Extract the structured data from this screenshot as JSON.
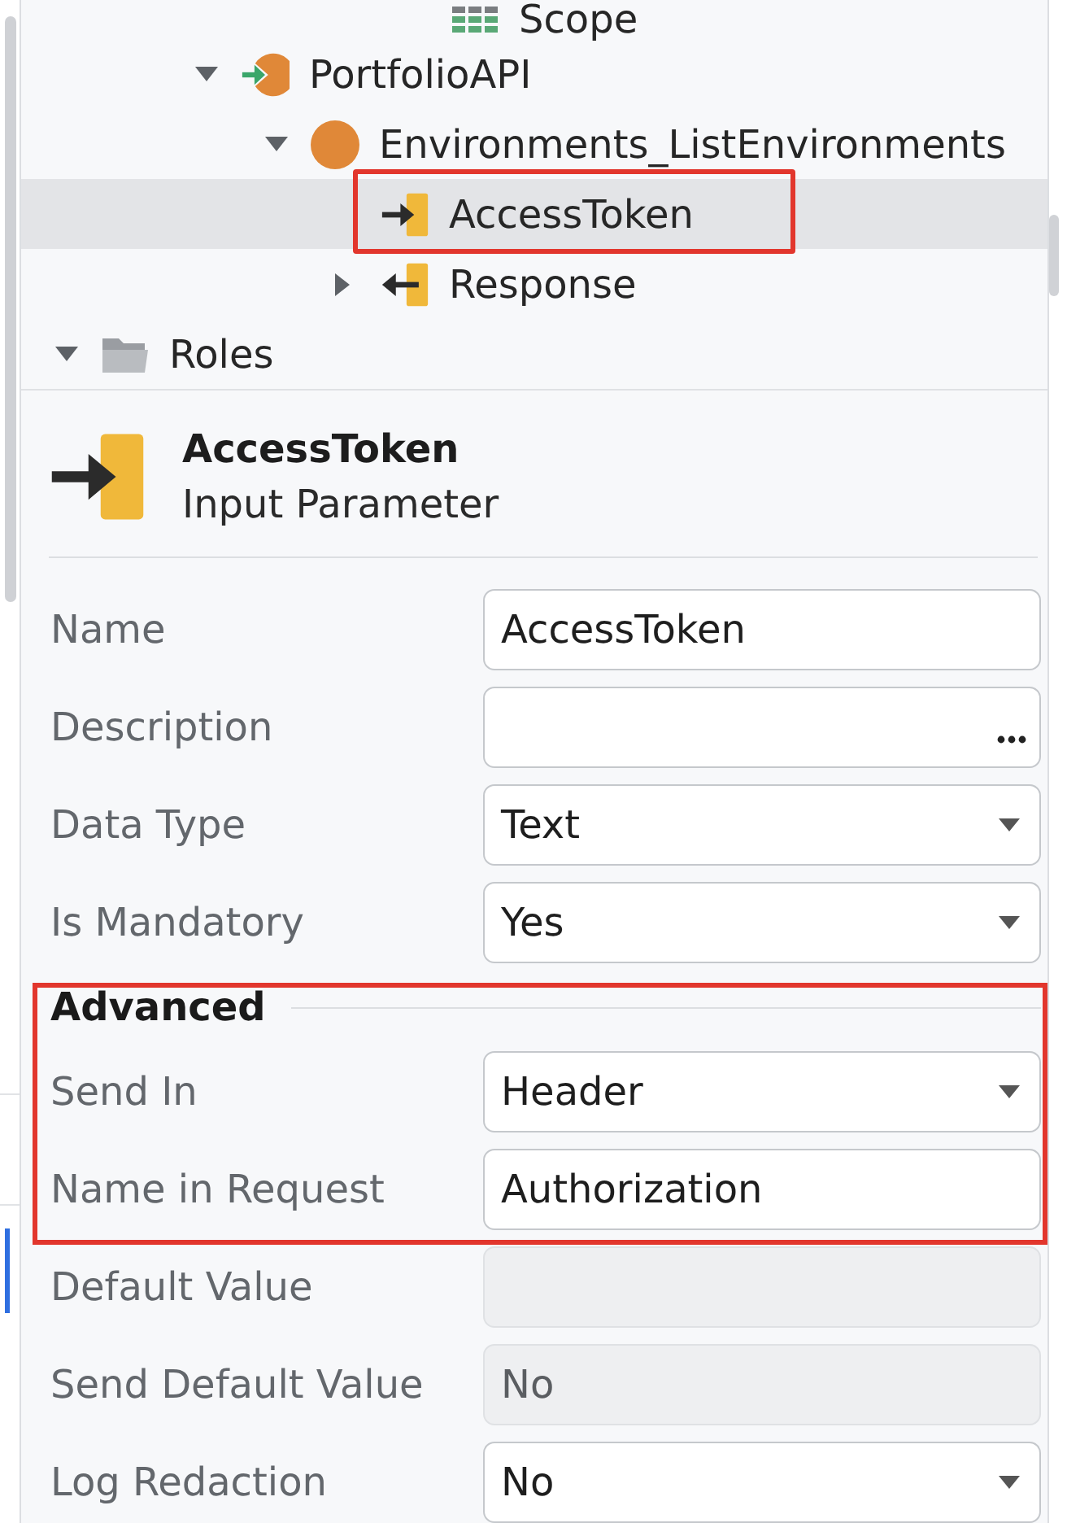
{
  "tree": {
    "items": [
      {
        "children": [
          {
            "children": [
              {
                "children": [
                  {
                    "children": [
                      {
                        "children": [
                          {
                            "label": "Scope",
                            "kind": "scope",
                            "selected": false,
                            "highlighted": false
                          }
                        ]
                      }
                    ]
                  }
                ]
              },
              {
                "label": "PortfolioAPI",
                "kind": "api",
                "expanded": true,
                "selected": false,
                "highlighted": false,
                "children": [
                  {
                    "label": "Environments_ListEnvironments",
                    "kind": "method",
                    "expanded": true,
                    "selected": false,
                    "highlighted": false,
                    "children": [
                      {
                        "label": "AccessToken",
                        "kind": "input",
                        "selected": true,
                        "highlighted": true
                      },
                      {
                        "label": "Response",
                        "kind": "output",
                        "expanded": false,
                        "selected": false,
                        "highlighted": false
                      }
                    ]
                  }
                ]
              }
            ]
          }
        ]
      },
      {
        "label": "Roles",
        "kind": "folder",
        "expanded": true,
        "selected": false,
        "highlighted": false
      }
    ]
  },
  "properties": {
    "kind": "input",
    "title": "AccessToken",
    "subtitle": "Input Parameter",
    "sections": [
      {
        "highlighted": false,
        "fields": [
          {
            "label": "Name",
            "kind": "text",
            "value": "AccessToken",
            "disabled": false
          },
          {
            "label": "Description",
            "kind": "text-more",
            "disabled": false
          },
          {
            "label": "Data Type",
            "kind": "select",
            "value": "Text",
            "disabled": false
          },
          {
            "label": "Is Mandatory",
            "kind": "select",
            "value": "Yes",
            "disabled": false
          }
        ]
      },
      {
        "heading": "Advanced",
        "highlighted": true,
        "fields": [
          {
            "label": "Send In",
            "kind": "select",
            "value": "Header",
            "disabled": false
          },
          {
            "label": "Name in Request",
            "kind": "text",
            "value": "Authorization",
            "disabled": false
          }
        ]
      },
      {
        "highlighted": false,
        "fields": [
          {
            "label": "Default Value",
            "kind": "text",
            "disabled": true
          },
          {
            "label": "Send Default Value",
            "kind": "text",
            "value": "No",
            "disabled": true
          },
          {
            "label": "Log Redaction",
            "kind": "select",
            "value": "No",
            "disabled": false
          }
        ]
      }
    ]
  }
}
